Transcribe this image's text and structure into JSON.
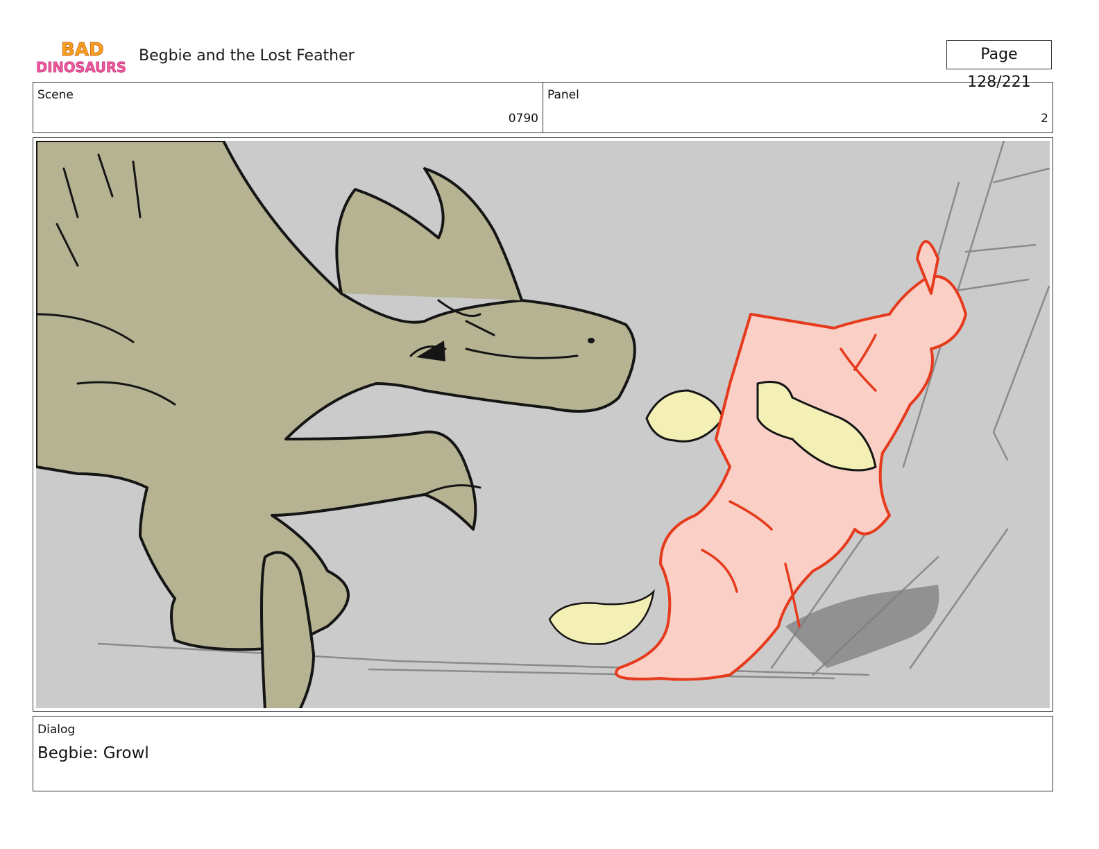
{
  "header": {
    "logo_text_top": "BAD",
    "logo_text_bottom": "DINOSAURS",
    "title": "Begbie and the Lost Feather",
    "page_label": "Page 128/221"
  },
  "info": {
    "scene_label": "Scene",
    "scene_value": "0790",
    "panel_label": "Panel",
    "panel_value": "2"
  },
  "panel": {
    "icon": "storyboard-sketch",
    "background_color": "#cbcbcb",
    "creature_color": "#b5b391",
    "character_color": "#f9cfc6",
    "character_outline": "#e63a1c",
    "feather_color": "#f4efb5"
  },
  "dialog": {
    "label": "Dialog",
    "text": "Begbie: Growl"
  }
}
